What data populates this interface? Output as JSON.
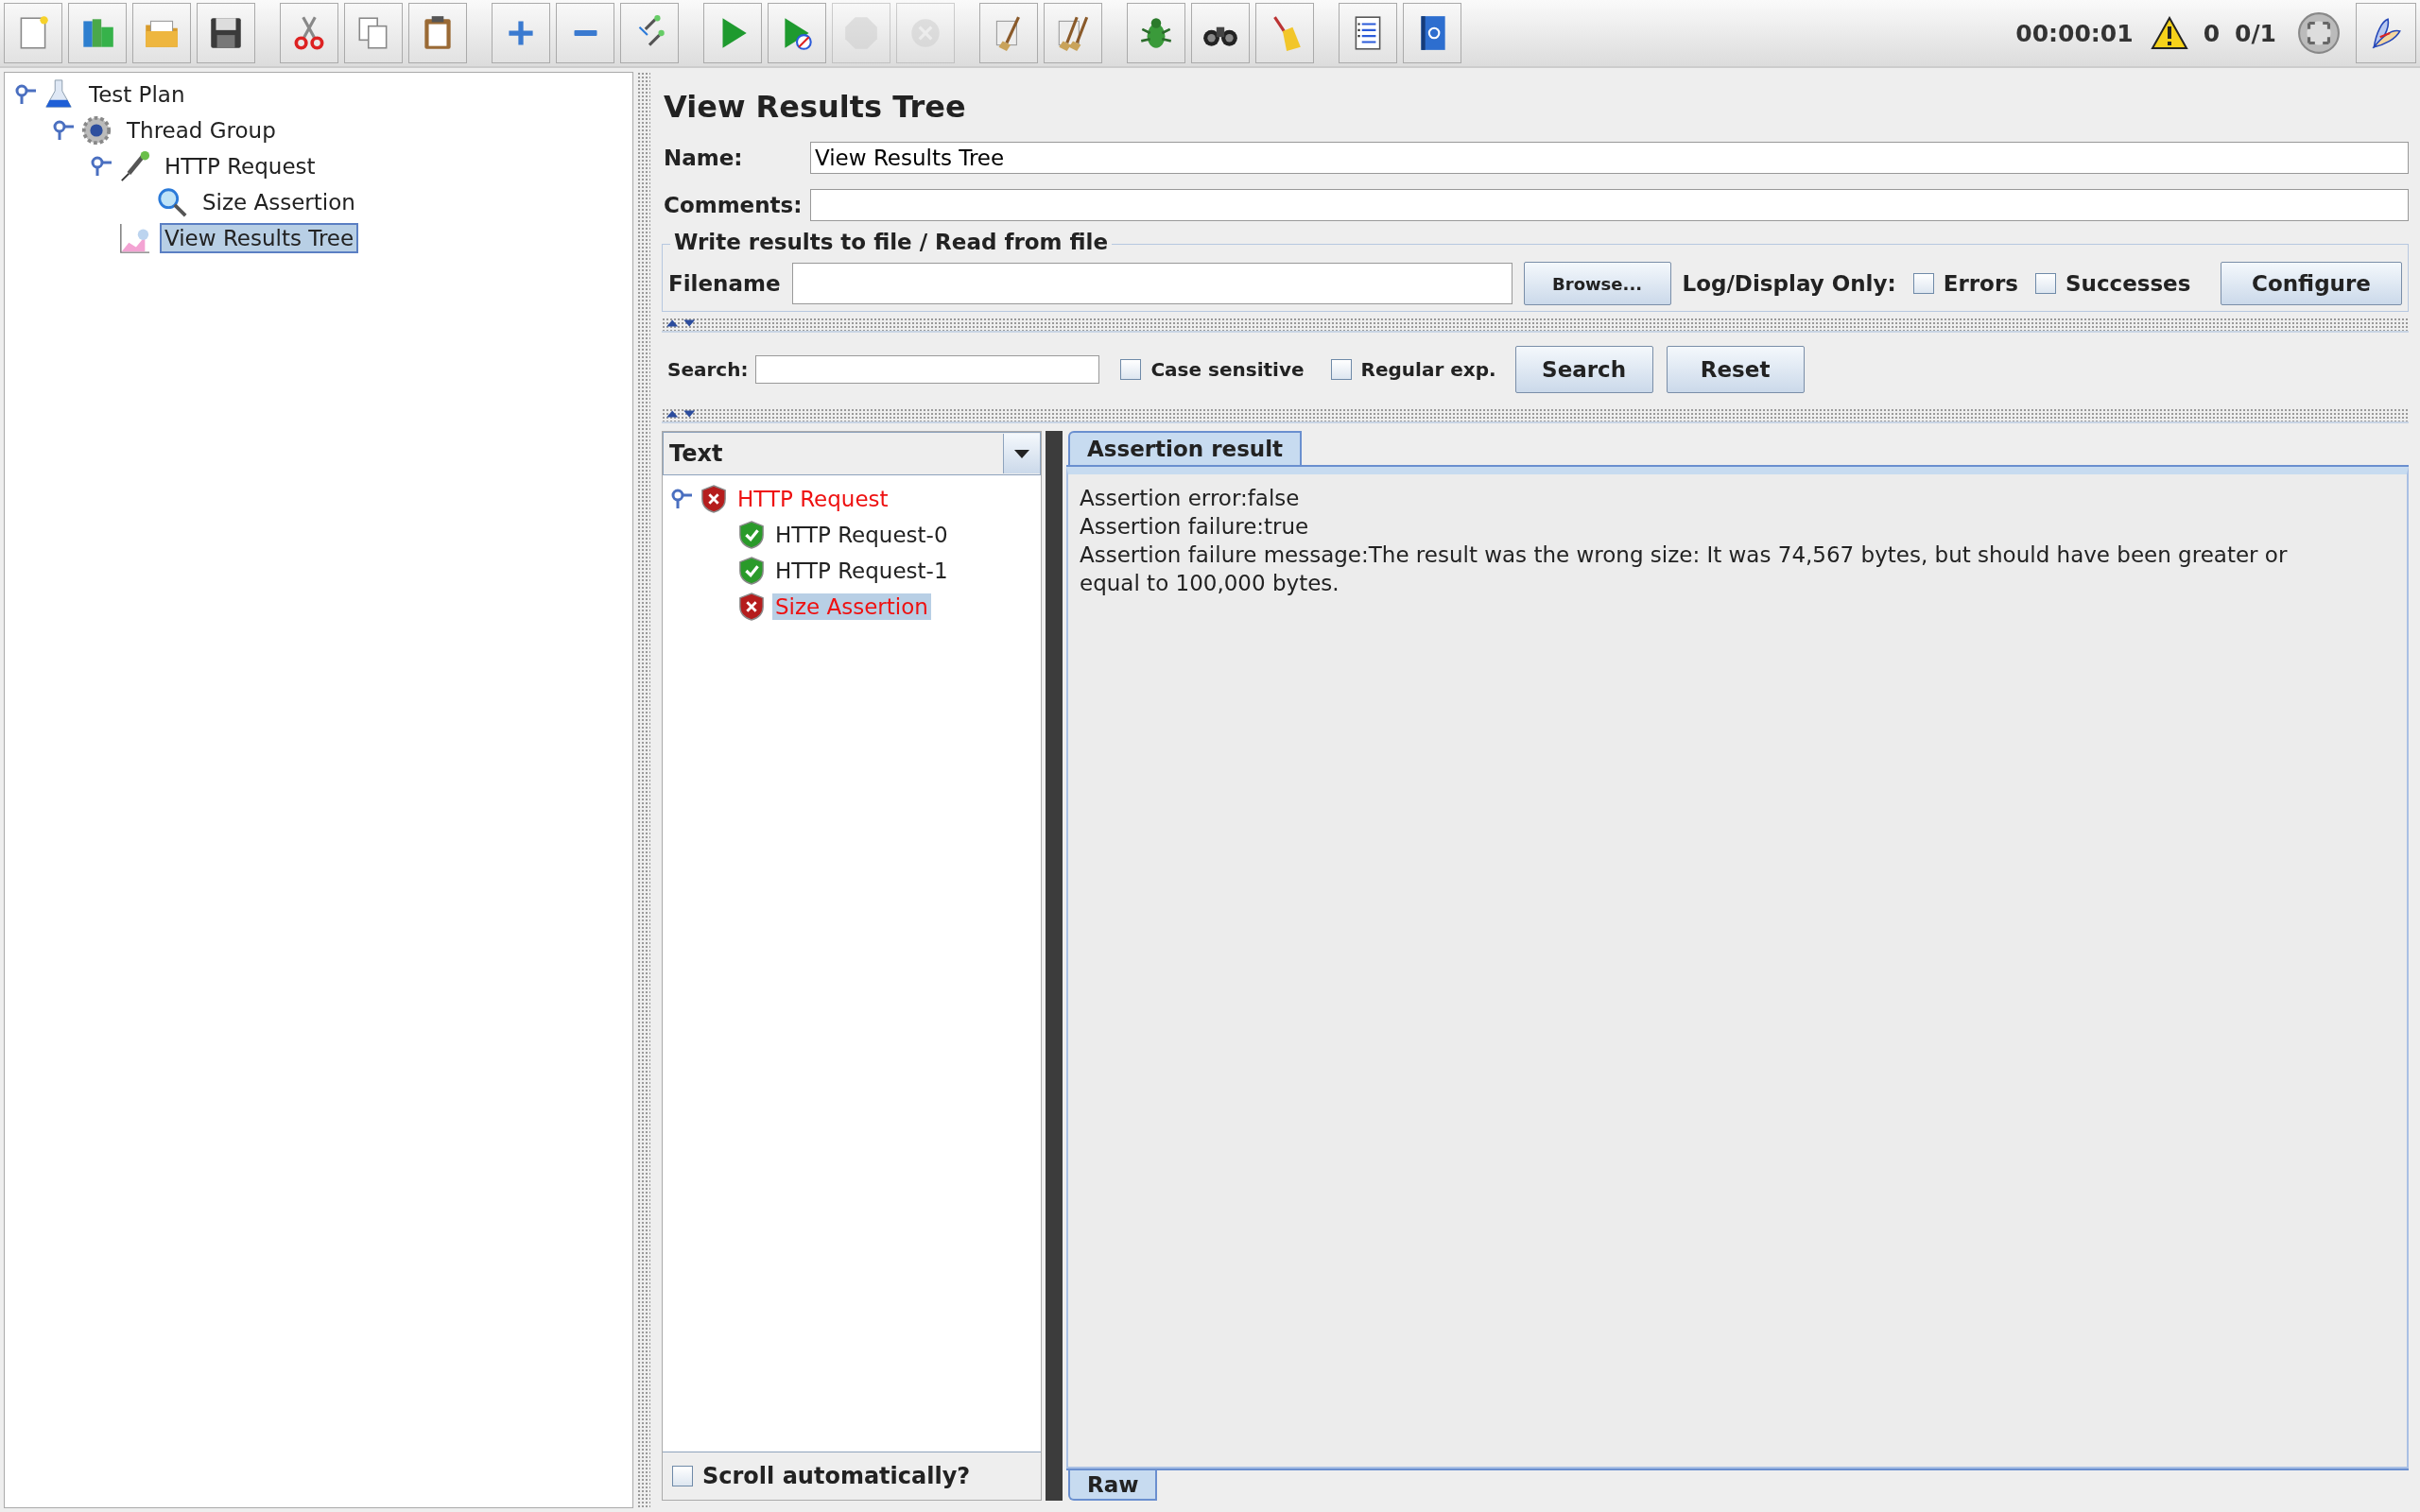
{
  "toolbar": {
    "groups": [
      [
        {
          "kind": "new",
          "disabled": false
        },
        {
          "kind": "templates",
          "disabled": false
        },
        {
          "kind": "open",
          "disabled": false
        },
        {
          "kind": "save",
          "disabled": false
        }
      ],
      [
        {
          "kind": "cut",
          "disabled": false
        },
        {
          "kind": "copy",
          "disabled": false
        },
        {
          "kind": "paste",
          "disabled": false
        }
      ],
      [
        {
          "kind": "expand",
          "disabled": false
        },
        {
          "kind": "collapse",
          "disabled": false
        },
        {
          "kind": "toggle",
          "disabled": false
        }
      ],
      [
        {
          "kind": "start",
          "disabled": false
        },
        {
          "kind": "start-no-pauses",
          "disabled": false
        },
        {
          "kind": "stop",
          "disabled": true
        },
        {
          "kind": "shutdown",
          "disabled": true
        }
      ],
      [
        {
          "kind": "clear",
          "disabled": false
        },
        {
          "kind": "clear-all",
          "disabled": false
        }
      ],
      [
        {
          "kind": "bug",
          "disabled": false
        },
        {
          "kind": "search",
          "disabled": false
        },
        {
          "kind": "broom",
          "disabled": false
        }
      ],
      [
        {
          "kind": "log",
          "disabled": false
        },
        {
          "kind": "help",
          "disabled": false
        }
      ]
    ],
    "timer": "00:00:01",
    "warnings": "0",
    "threads": "0/1"
  },
  "tree": [
    {
      "label": "Test Plan",
      "kind": "test-plan",
      "selected": false,
      "expanded": true,
      "children": [
        {
          "label": "Thread Group",
          "kind": "thread-group",
          "selected": false,
          "expanded": true,
          "children": [
            {
              "label": "HTTP Request",
              "kind": "sampler",
              "selected": false,
              "expanded": true,
              "children": [
                {
                  "label": "Size Assertion",
                  "kind": "assertion",
                  "selected": false
                }
              ]
            },
            {
              "label": "View Results Tree",
              "kind": "listener",
              "selected": true
            }
          ]
        }
      ]
    }
  ],
  "panel": {
    "title": "View Results Tree",
    "name": {
      "label": "Name:",
      "value": "View Results Tree"
    },
    "comments": {
      "label": "Comments:"
    },
    "file_group": {
      "legend": "Write results to file / Read from file",
      "filename_label": "Filename",
      "browse": "Browse...",
      "log_label": "Log/Display Only:",
      "options": [
        {
          "label": "Errors",
          "checked": false
        },
        {
          "label": "Successes",
          "checked": false
        }
      ],
      "configure": "Configure"
    },
    "search": {
      "label": "Search:",
      "options": [
        {
          "label": "Case sensitive",
          "checked": false
        },
        {
          "label": "Regular exp.",
          "checked": false
        }
      ],
      "search_button": "Search",
      "reset_button": "Reset"
    },
    "renderer": "Text",
    "results": [
      {
        "label": "HTTP Request",
        "kind": "failed",
        "selected": false,
        "expanded": true,
        "children": [
          {
            "label": "HTTP Request-0",
            "kind": "passed",
            "selected": false
          },
          {
            "label": "HTTP Request-1",
            "kind": "passed",
            "selected": false
          },
          {
            "label": "Size Assertion",
            "kind": "failed",
            "selected": true
          }
        ]
      }
    ],
    "scroll_auto": {
      "label": "Scroll automatically?",
      "checked": false
    },
    "top_tabs": [
      {
        "label": "Assertion result",
        "selected": true
      }
    ],
    "result_lines": [
      "Assertion error:false",
      "Assertion failure:true",
      "Assertion failure message:The result was the wrong size: It was 74,567 bytes, but should have been greater or equal to 100,000 bytes."
    ],
    "bottom_tabs": [
      {
        "label": "Raw",
        "selected": true
      }
    ]
  }
}
